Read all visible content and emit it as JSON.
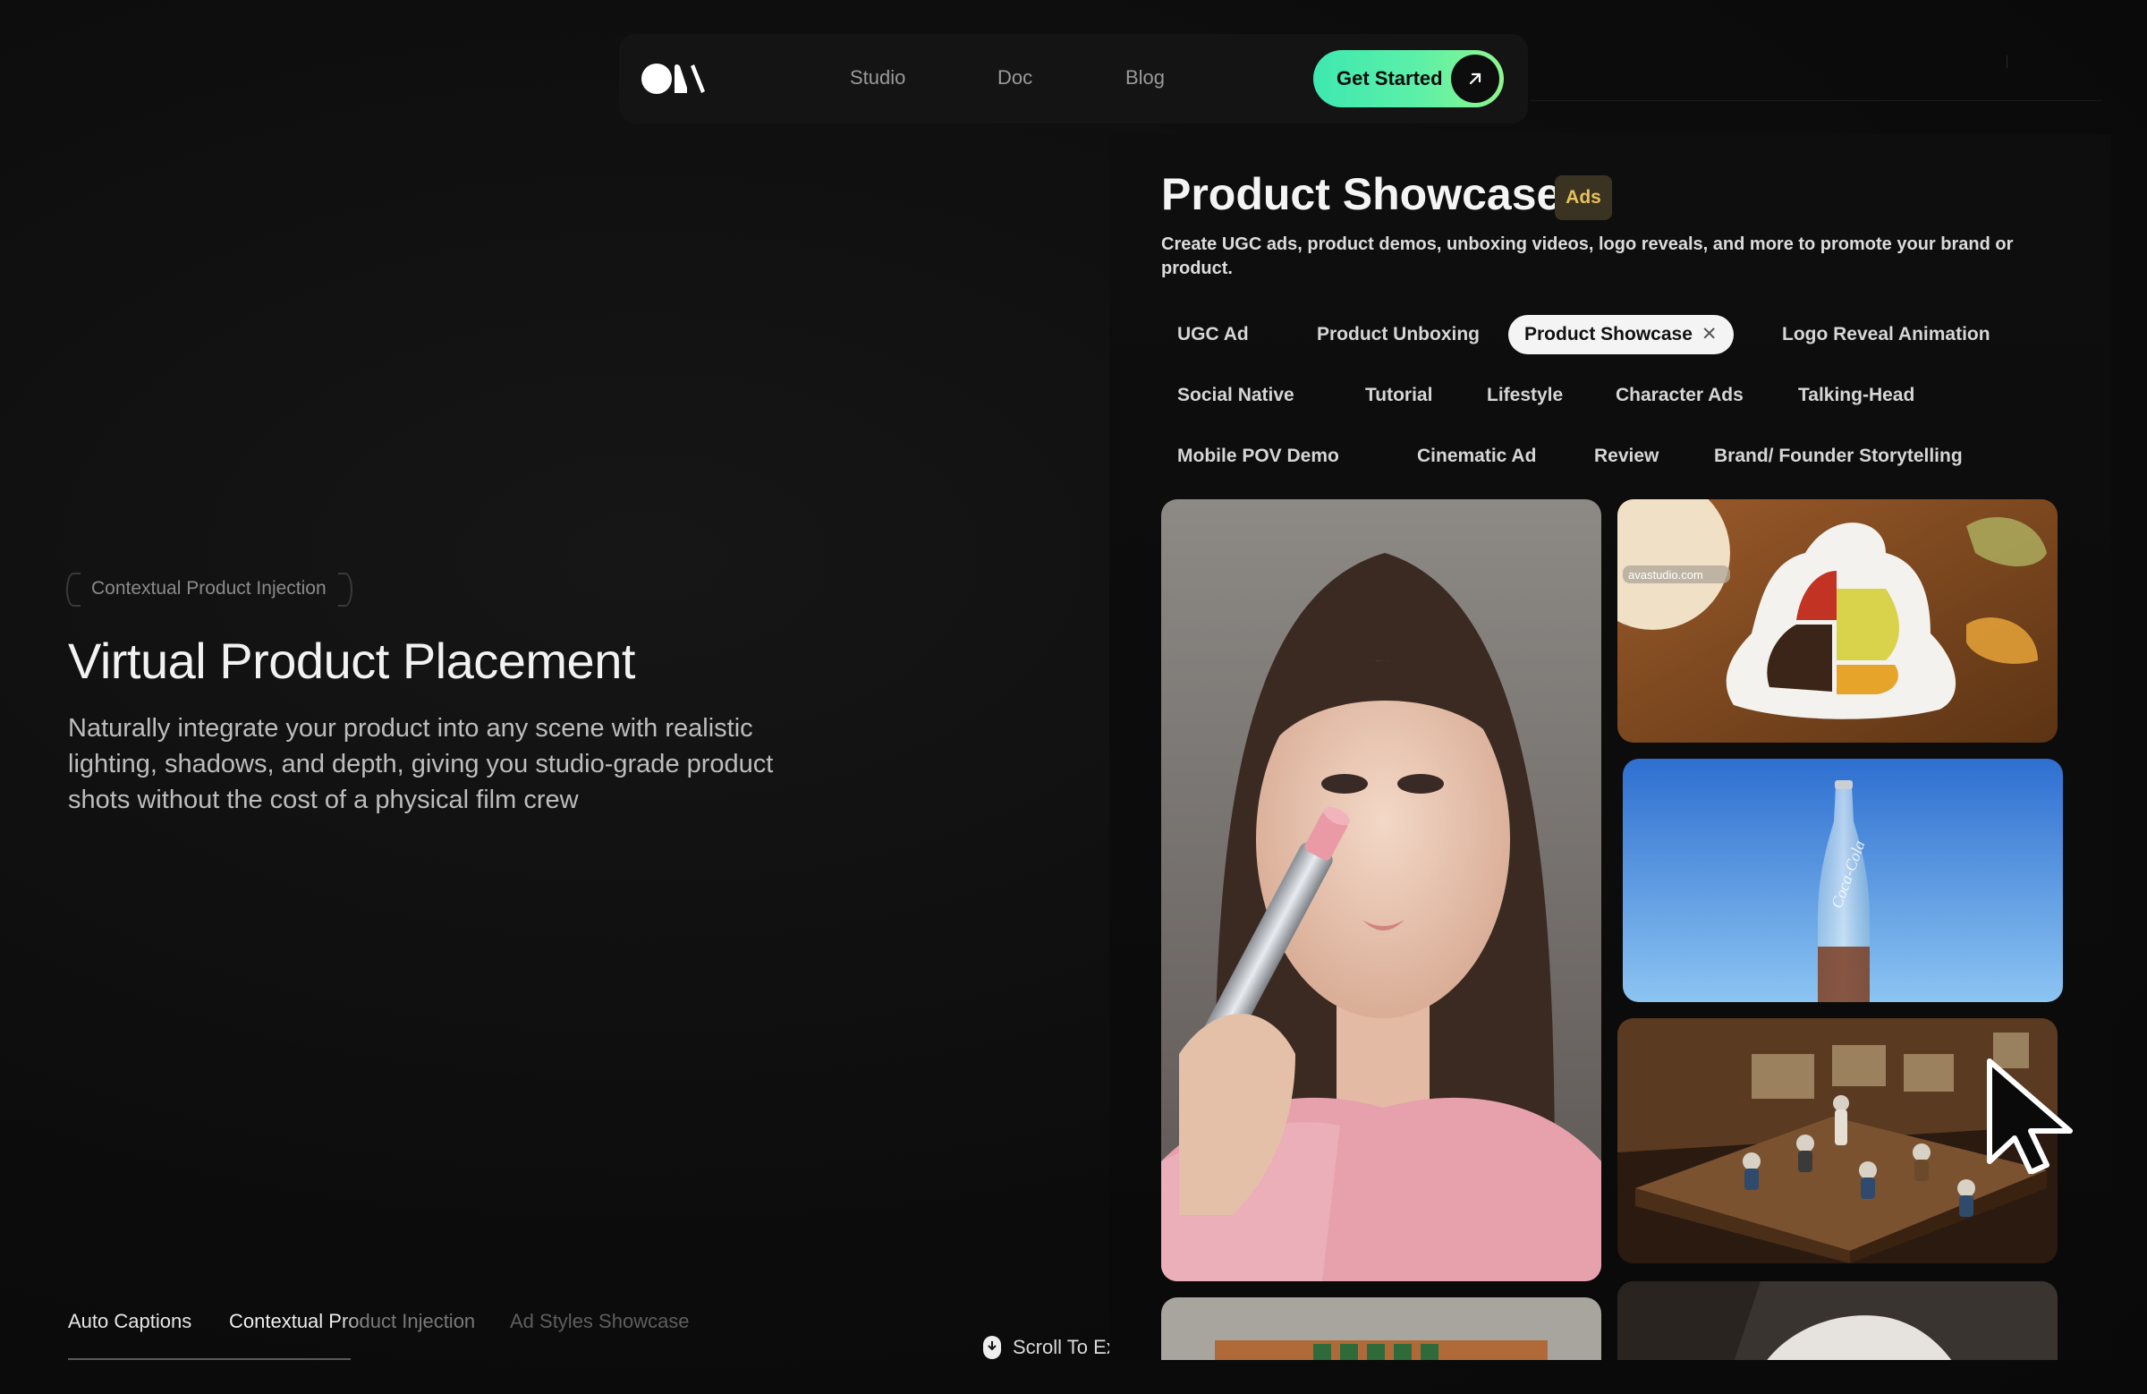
{
  "nav": {
    "logo_icon": "brand-logo-icon",
    "links": [
      "Studio",
      "Doc",
      "Blog"
    ],
    "cta_label": "Get Started",
    "cta_icon": "arrow-up-right-icon",
    "cta_gradient": [
      "#3ee8b0",
      "#8ef58e"
    ]
  },
  "hero": {
    "pill": "Contextual Product Injection",
    "title": "Virtual Product Placement",
    "description": "Naturally integrate your product into any scene with realistic lighting, shadows, and depth, giving you studio-grade product shots without the cost of a physical film crew"
  },
  "bottom_tabs": {
    "items": [
      "Auto Captions",
      "Contextual Product Injection",
      "Ad Styles Showcase"
    ],
    "active_index": 1
  },
  "scroll_hint": {
    "label": "Scroll To Explore",
    "icon": "mouse-icon"
  },
  "showcase": {
    "title": "Product Showcase",
    "badge": "Ads",
    "badge_color": "#e8c25a",
    "description": "Create UGC ads, product demos, unboxing videos, logo reveals, and more to promote your brand or product.",
    "chips": [
      "UGC Ad",
      "Product Unboxing",
      "Product Showcase",
      "Logo Reveal Animation",
      "Social Native",
      "Tutorial",
      "Lifestyle",
      "Character Ads",
      "Talking-Head",
      "Mobile POV Demo",
      "Cinematic Ad",
      "Review",
      "Brand/ Founder Storytelling"
    ],
    "active_chip": "Product Showcase",
    "watermark": "avastudio.com",
    "bottle_text": "Coca-Cola"
  }
}
